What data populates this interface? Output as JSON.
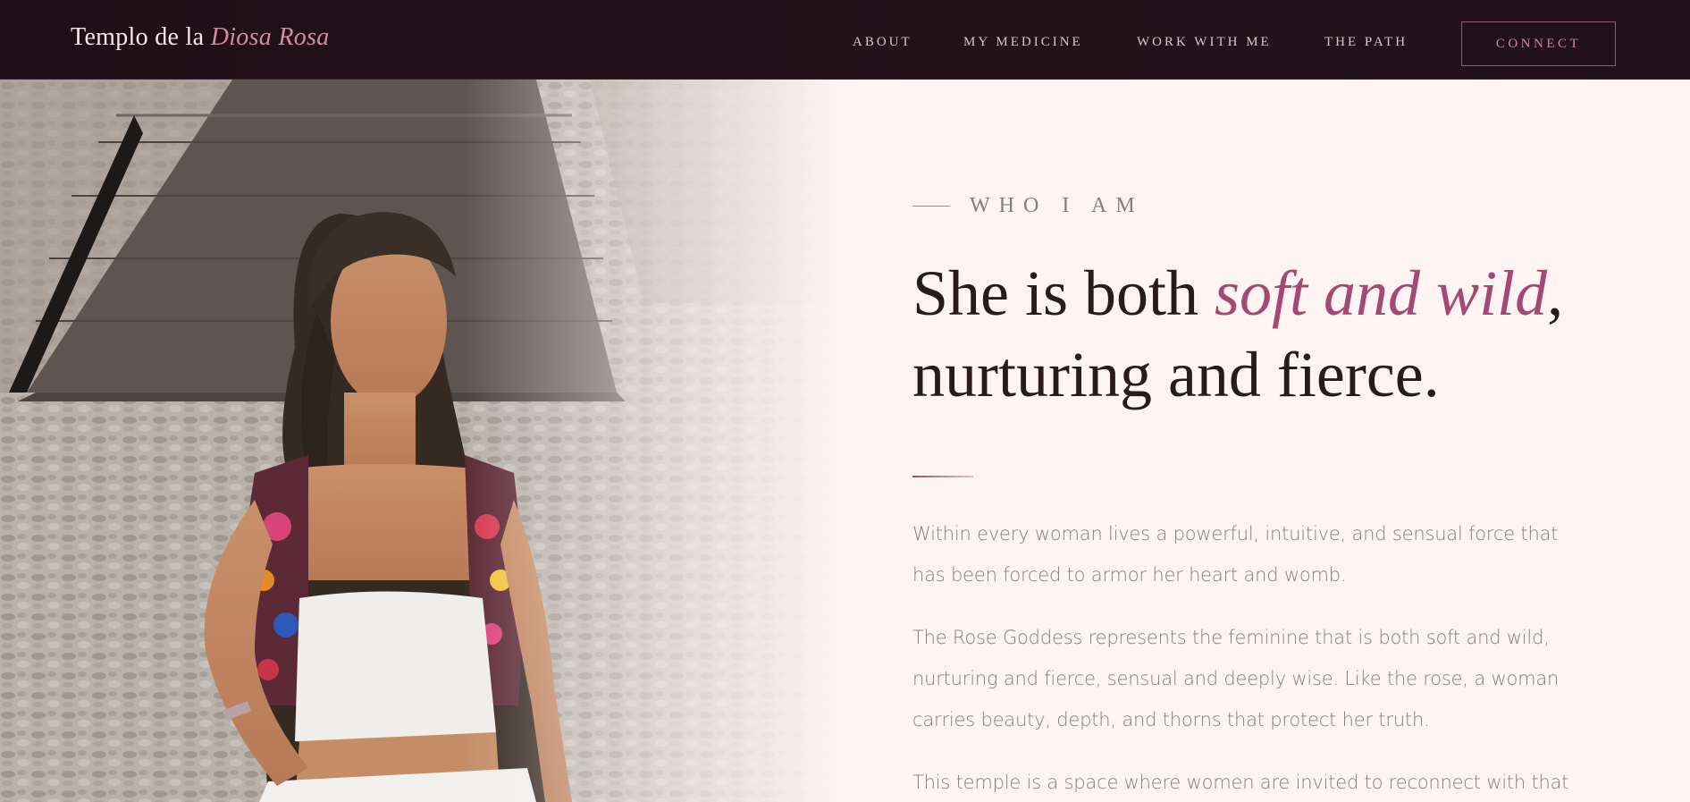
{
  "header": {
    "logo_main": "Templo de la",
    "logo_accent": "Diosa Rosa",
    "nav": {
      "about": "ABOUT",
      "medicine": "MY MEDICINE",
      "work": "WORK WITH ME",
      "path": "THE PATH"
    },
    "connect_label": "CONNECT"
  },
  "about": {
    "eyebrow": "WHO I AM",
    "headline_start": "She is both ",
    "headline_accent": "soft and wild",
    "headline_end": ",",
    "headline_line2": "nurturing and fierce.",
    "paragraph_1": "Within every woman lives a powerful, intuitive, and sensual force that has been forced to armor her heart and womb.",
    "paragraph_2": "The Rose Goddess represents the feminine that is both soft and wild, nurturing and fierce, sensual and deeply wise. Like the rose, a woman carries beauty, depth, and thorns that protect her truth.",
    "paragraph_3": "This temple is a space where women are invited to reconnect with that"
  },
  "colors": {
    "nav_bg": "#1e0f16",
    "page_bg": "#fdf4f3",
    "accent": "#a44a72",
    "logo_accent": "#d9899e"
  }
}
